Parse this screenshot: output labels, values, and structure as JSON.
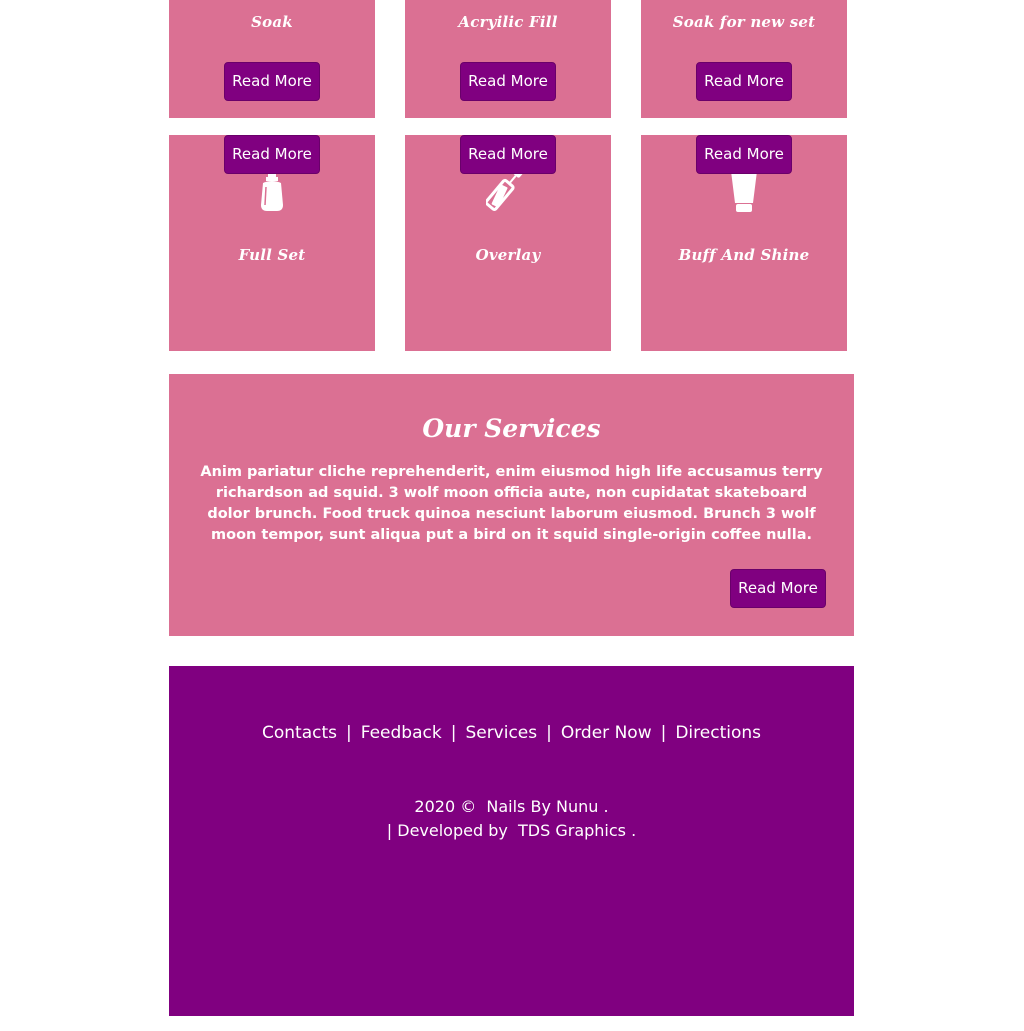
{
  "cards": [
    {
      "title": "Soak",
      "button": "Read More",
      "icon": "none"
    },
    {
      "title": "Acryilic Fill",
      "button": "Read More",
      "icon": "none"
    },
    {
      "title": "Soak for new set",
      "button": "Read More",
      "icon": "none"
    },
    {
      "title": "Full Set",
      "button": "Read More",
      "icon": "nail-polish-icon"
    },
    {
      "title": "Overlay",
      "button": "Read More",
      "icon": "mascara-icon"
    },
    {
      "title": "Buff And Shine",
      "button": "Read More",
      "icon": "cream-tube-icon"
    }
  ],
  "services": {
    "title": "Our Services",
    "text": "Anim pariatur cliche reprehenderit, enim eiusmod high life accusamus terry richardson ad squid. 3 wolf moon officia aute, non cupidatat skateboard dolor brunch. Food truck quinoa nesciunt laborum eiusmod. Brunch 3 wolf moon tempor, sunt aliqua put a bird on it squid single-origin coffee nulla.",
    "button": "Read More"
  },
  "footer": {
    "nav": [
      "Contacts",
      "Feedback",
      "Services",
      "Order Now",
      "Directions"
    ],
    "separator": "|",
    "copyright_prefix": "2020 ©",
    "brand": "Nails By Nunu",
    "period": ".",
    "developed_prefix": "| Developed by",
    "developer": "TDS Graphics"
  },
  "colors": {
    "card": "#db7093",
    "button": "#800080",
    "footer": "#800080",
    "text": "#ffffff"
  }
}
